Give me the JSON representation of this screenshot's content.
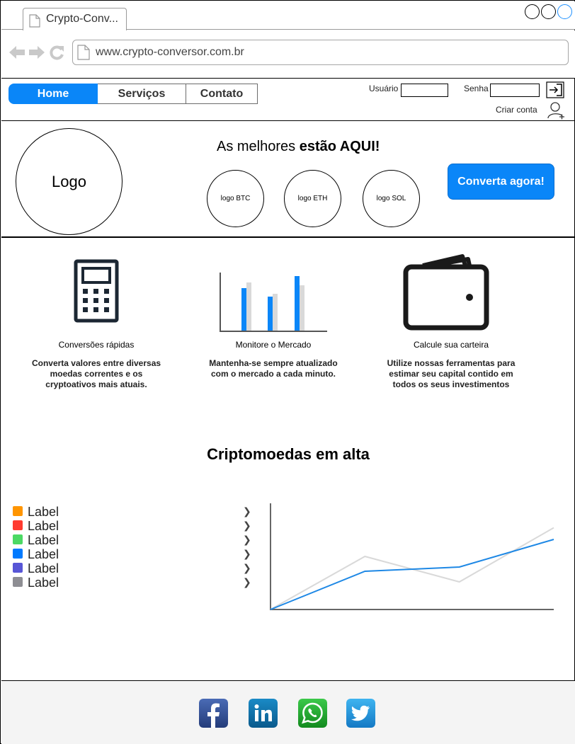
{
  "browser": {
    "tab_title": "Crypto-Conv...",
    "url": "www.crypto-conversor.com.br"
  },
  "nav": {
    "items": [
      {
        "label": "Home"
      },
      {
        "label": "Serviços"
      },
      {
        "label": "Contato"
      }
    ],
    "user_label": "Usuário",
    "password_label": "Senha",
    "create_account": "Criar conta"
  },
  "hero": {
    "logo_text": "Logo",
    "title_normal": "As melhores ",
    "title_bold": "estão AQUI!",
    "coins": [
      "logo BTC",
      "logo ETH",
      "logo SOL"
    ],
    "cta": "Converta agora!"
  },
  "features": [
    {
      "title": "Conversões rápidas",
      "icon": "calculator-icon",
      "desc": "Converta valores entre diversas moedas correntes e os cryptoativos mais atuais."
    },
    {
      "title": "Monitore o Mercado",
      "icon": "bar-chart-icon",
      "desc": "Mantenha-se sempre atualizado com o mercado a cada minuto."
    },
    {
      "title": "Calcule sua carteira",
      "icon": "wallet-icon",
      "desc": "Utilize nossas ferramentas para estimar seu capital contido em todos os seus investimentos"
    }
  ],
  "trending": {
    "title": "Criptomoedas em alta",
    "legend": [
      {
        "label": "Label",
        "color": "#ff9500"
      },
      {
        "label": "Label",
        "color": "#ff3b30"
      },
      {
        "label": "Label",
        "color": "#4cd964"
      },
      {
        "label": "Label",
        "color": "#007aff"
      },
      {
        "label": "Label",
        "color": "#5856d6"
      },
      {
        "label": "Label",
        "color": "#8e8e93"
      }
    ]
  },
  "chart_data": {
    "type": "line",
    "x": [
      0,
      1,
      2,
      3
    ],
    "ylim": [
      0,
      10
    ],
    "series": [
      {
        "color": "#1e88e5",
        "values": [
          0,
          3.6,
          4.0,
          6.6
        ]
      },
      {
        "color": "#d9d9d9",
        "values": [
          0,
          5.0,
          2.6,
          7.7
        ]
      }
    ]
  },
  "footer": {
    "social": [
      {
        "icon": "facebook-icon",
        "color": "#3b5998"
      },
      {
        "icon": "linkedin-icon",
        "color": "#0e76a8"
      },
      {
        "icon": "whatsapp-icon",
        "color": "#25d366"
      },
      {
        "icon": "twitter-icon",
        "color": "#1da1f2"
      }
    ]
  }
}
